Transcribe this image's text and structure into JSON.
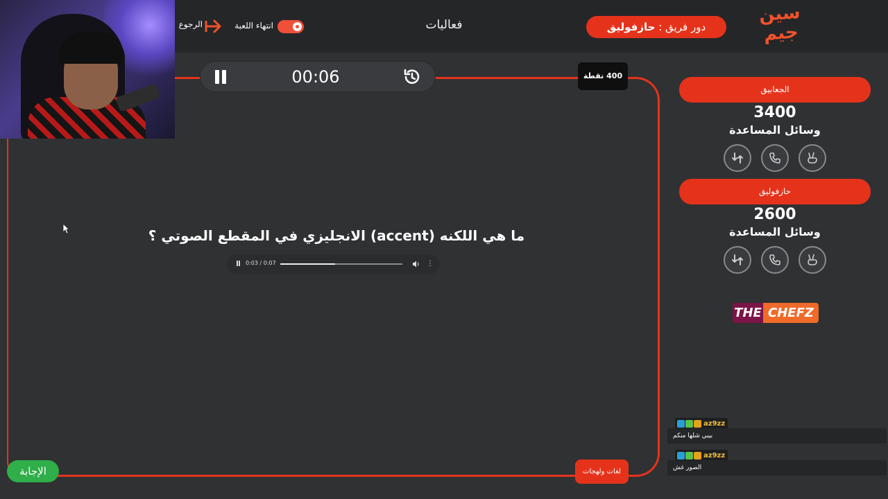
{
  "header": {
    "logo_text": "سين جيم",
    "turn_prefix": "دور فريق :",
    "turn_team": "حازفوليق",
    "page_heading": "فعاليات",
    "end_game_label": "انتهاء اللعبة",
    "back_label": "الرجوع"
  },
  "question_panel": {
    "timer": "00:06",
    "points": "400 نقطة",
    "question_text": "ما هي اللكنه (accent) الانجليزي في المقطع الصوتي ؟",
    "category": "لغات ولهجات",
    "answer_label": "الإجابة"
  },
  "audio_player": {
    "time": "0:03 / 0:07",
    "progress": 0.45
  },
  "teams": [
    {
      "name": "الجعابيق",
      "score": "3400",
      "aids_label": "وسائل المساعدة"
    },
    {
      "name": "حازفوليق",
      "score": "2600",
      "aids_label": "وسائل المساعدة"
    }
  ],
  "aid_icons": [
    "swap-icon",
    "phone-icon",
    "two-answers-icon"
  ],
  "sponsor": {
    "part1": "THE",
    "part2": "CHEFZ"
  },
  "chat": [
    {
      "user": "az9zz",
      "message": "بيبي شلها منكم"
    },
    {
      "user": "az9zz",
      "message": "الصور غش"
    }
  ],
  "colors": {
    "accent": "#e5331b",
    "answer": "#2fae4a",
    "background": "#303133",
    "topbar": "#252628"
  }
}
